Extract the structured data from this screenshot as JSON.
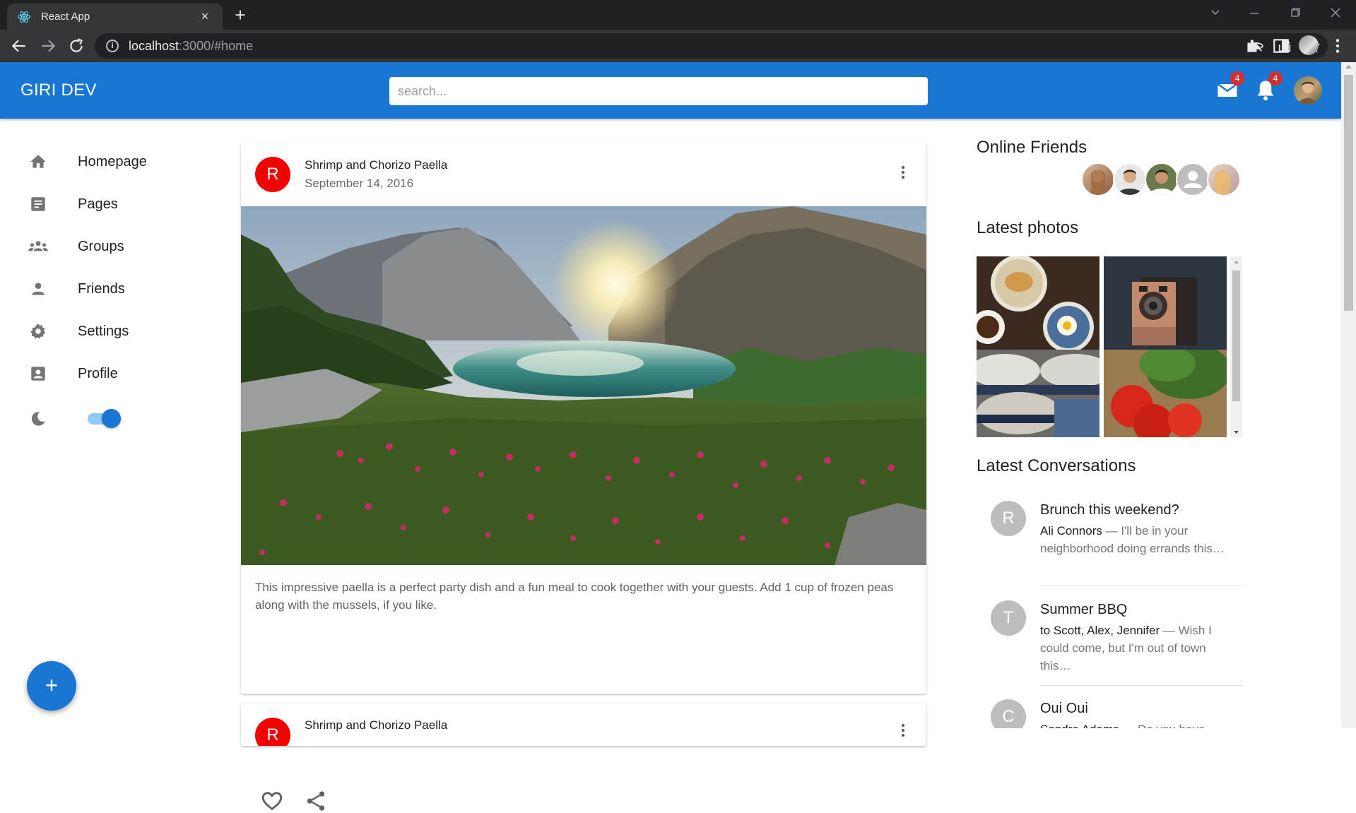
{
  "browser": {
    "tab_title": "React App",
    "tab_close": "×",
    "new_tab": "+",
    "url_host": "localhost",
    "url_rest": ":3000/#home"
  },
  "header": {
    "brand": "GIRI DEV",
    "search_placeholder": "search...",
    "mail_badge": "4",
    "notifications_badge": "4",
    "accent_color": "#1976d2"
  },
  "sidebar": {
    "items": [
      {
        "label": "Homepage",
        "icon": "home-icon"
      },
      {
        "label": "Pages",
        "icon": "article-icon"
      },
      {
        "label": "Groups",
        "icon": "groups-icon"
      },
      {
        "label": "Friends",
        "icon": "person-icon"
      },
      {
        "label": "Settings",
        "icon": "gear-icon"
      },
      {
        "label": "Profile",
        "icon": "account-box-icon"
      }
    ],
    "dark_mode_toggle": "on"
  },
  "fab": {
    "label": "+"
  },
  "feed": {
    "posts": [
      {
        "avatar_letter": "R",
        "title": "Shrimp and Chorizo Paella",
        "date": "September 14, 2016",
        "image": "mountain-lake-flowers",
        "text": "This impressive paella is a perfect party dish and a fun meal to cook together with your guests. Add 1 cup of frozen peas along with the mussels, if you like."
      },
      {
        "avatar_letter": "R",
        "title": "Shrimp and Chorizo Paella"
      }
    ]
  },
  "right": {
    "online_friends_title": "Online Friends",
    "latest_photos_title": "Latest photos",
    "latest_conversations_title": "Latest Conversations",
    "conversations": [
      {
        "letter": "R",
        "title": "Brunch this weekend?",
        "from": "Ali Connors",
        "snippet": " — I'll be in your neighborhood doing errands this…"
      },
      {
        "letter": "T",
        "title": "Summer BBQ",
        "from": "to Scott, Alex, Jennifer",
        "snippet": " — Wish I could come, but I'm out of town this…"
      },
      {
        "letter": "C",
        "title": "Oui Oui",
        "from": "Sandra Adams",
        "snippet": " — Do you have"
      }
    ]
  }
}
